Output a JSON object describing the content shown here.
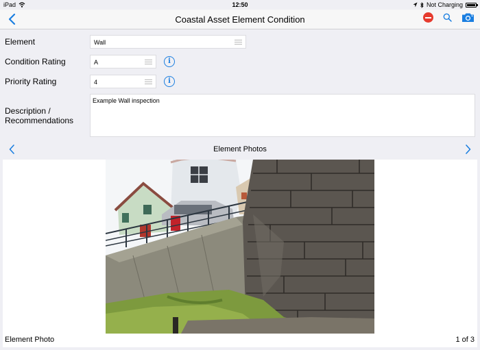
{
  "status_bar": {
    "device": "iPad",
    "time": "12:50",
    "charging": "Not Charging"
  },
  "nav": {
    "title": "Coastal Asset Element Condition",
    "icons": [
      "chevron-left-icon",
      "delete-icon",
      "search-icon",
      "camera-icon"
    ]
  },
  "form": {
    "element": {
      "label": "Element",
      "value": "Wall"
    },
    "condition_rating": {
      "label": "Condition Rating",
      "value": "A"
    },
    "priority_rating": {
      "label": "Priority Rating",
      "value": "4"
    },
    "description": {
      "label_line1": "Description /",
      "label_line2": "Recommendations",
      "value": "Example Wall inspection"
    }
  },
  "photos": {
    "header": "Element Photos",
    "caption": "Element Photo",
    "counter": "1 of 3"
  },
  "colors": {
    "accent": "#1a7ee0",
    "delete": "#e63b2e",
    "background": "#efeff4"
  }
}
